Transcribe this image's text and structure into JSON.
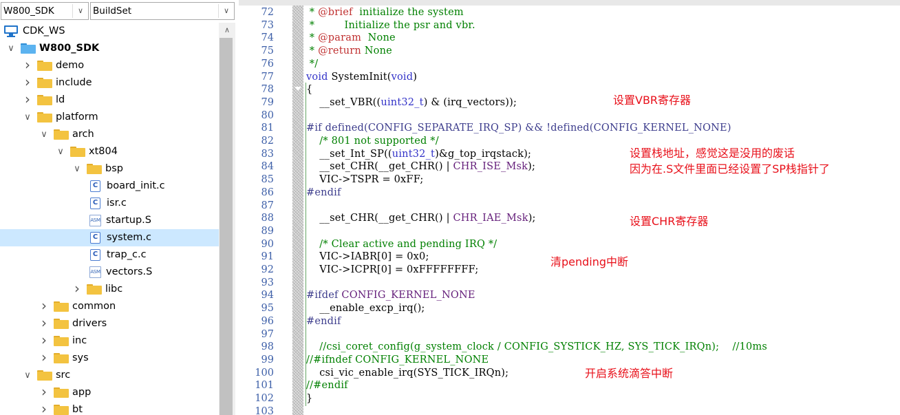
{
  "workspace_combo": {
    "value": "W800_SDK"
  },
  "config_combo": {
    "value": "BuildSet"
  },
  "tree": [
    {
      "label": "CDK_WS",
      "depth": 0,
      "kind": "workspace",
      "expanded": null,
      "selected": false
    },
    {
      "label": "W800_SDK",
      "depth": 0,
      "kind": "project",
      "expanded": true,
      "selected": false,
      "bold": true
    },
    {
      "label": "demo",
      "depth": 1,
      "kind": "folder",
      "expanded": false,
      "selected": false
    },
    {
      "label": "include",
      "depth": 1,
      "kind": "folder",
      "expanded": false,
      "selected": false
    },
    {
      "label": "ld",
      "depth": 1,
      "kind": "folder",
      "expanded": false,
      "selected": false
    },
    {
      "label": "platform",
      "depth": 1,
      "kind": "folder",
      "expanded": true,
      "selected": false
    },
    {
      "label": "arch",
      "depth": 2,
      "kind": "folder",
      "expanded": true,
      "selected": false
    },
    {
      "label": "xt804",
      "depth": 3,
      "kind": "folder",
      "expanded": true,
      "selected": false
    },
    {
      "label": "bsp",
      "depth": 4,
      "kind": "folder",
      "expanded": true,
      "selected": false
    },
    {
      "label": "board_init.c",
      "depth": 5,
      "kind": "c-file",
      "expanded": null,
      "selected": false
    },
    {
      "label": "isr.c",
      "depth": 5,
      "kind": "c-file",
      "expanded": null,
      "selected": false
    },
    {
      "label": "startup.S",
      "depth": 5,
      "kind": "asm-file",
      "expanded": null,
      "selected": false
    },
    {
      "label": "system.c",
      "depth": 5,
      "kind": "c-file",
      "expanded": null,
      "selected": true
    },
    {
      "label": "trap_c.c",
      "depth": 5,
      "kind": "c-file",
      "expanded": null,
      "selected": false
    },
    {
      "label": "vectors.S",
      "depth": 5,
      "kind": "asm-file",
      "expanded": null,
      "selected": false
    },
    {
      "label": "libc",
      "depth": 4,
      "kind": "folder",
      "expanded": false,
      "selected": false
    },
    {
      "label": "common",
      "depth": 2,
      "kind": "folder",
      "expanded": false,
      "selected": false
    },
    {
      "label": "drivers",
      "depth": 2,
      "kind": "folder",
      "expanded": false,
      "selected": false
    },
    {
      "label": "inc",
      "depth": 2,
      "kind": "folder",
      "expanded": false,
      "selected": false
    },
    {
      "label": "sys",
      "depth": 2,
      "kind": "folder",
      "expanded": false,
      "selected": false
    },
    {
      "label": "src",
      "depth": 1,
      "kind": "folder",
      "expanded": true,
      "selected": false
    },
    {
      "label": "app",
      "depth": 2,
      "kind": "folder",
      "expanded": false,
      "selected": false
    },
    {
      "label": "bt",
      "depth": 2,
      "kind": "folder",
      "expanded": false,
      "selected": false
    }
  ],
  "icons": {
    "c_file": "C",
    "asm_file": "ASM"
  },
  "code_lines": [
    {
      "num": "72",
      "segs": [
        [
          "cm",
          " * "
        ],
        [
          "an",
          "@brief"
        ],
        [
          "cm",
          "  initialize the system"
        ]
      ]
    },
    {
      "num": "73",
      "segs": [
        [
          "cm",
          " *         Initialize the psr and vbr."
        ]
      ]
    },
    {
      "num": "74",
      "segs": [
        [
          "cm",
          " * "
        ],
        [
          "an",
          "@param"
        ],
        [
          "cm",
          "  None"
        ]
      ]
    },
    {
      "num": "75",
      "segs": [
        [
          "cm",
          " * "
        ],
        [
          "an",
          "@return"
        ],
        [
          "cm",
          " None"
        ]
      ]
    },
    {
      "num": "76",
      "segs": [
        [
          "cm",
          " */"
        ]
      ]
    },
    {
      "num": "77",
      "segs": [
        [
          "kw",
          "void"
        ],
        [
          "",
          " SystemInit("
        ],
        [
          "kw",
          "void"
        ],
        [
          "",
          ")"
        ]
      ]
    },
    {
      "num": "78",
      "segs": [
        [
          "",
          "{"
        ]
      ]
    },
    {
      "num": "79",
      "segs": [
        [
          "",
          "    __set_VBR(("
        ],
        [
          "kw",
          "uint32_t"
        ],
        [
          "",
          ") & (irq_vectors));"
        ]
      ]
    },
    {
      "num": "80",
      "segs": []
    },
    {
      "num": "81",
      "segs": [
        [
          "pp",
          "#if defined(CONFIG_SEPARATE_IRQ_SP) && !defined(CONFIG_KERNEL_NONE)"
        ]
      ]
    },
    {
      "num": "82",
      "segs": [
        [
          "cm",
          "    /* 801 not supported */"
        ]
      ]
    },
    {
      "num": "83",
      "segs": [
        [
          "",
          "    __set_Int_SP(("
        ],
        [
          "kw",
          "uint32_t"
        ],
        [
          "",
          ")&g_top_irqstack);"
        ]
      ]
    },
    {
      "num": "84",
      "segs": [
        [
          "",
          "    __set_CHR(__get_CHR() | "
        ],
        [
          "mac",
          "CHR_ISE_Msk"
        ],
        [
          "",
          ");"
        ]
      ]
    },
    {
      "num": "85",
      "segs": [
        [
          "",
          "    VIC->TSPR = 0xFF;"
        ]
      ]
    },
    {
      "num": "86",
      "segs": [
        [
          "pp",
          "#endif"
        ]
      ]
    },
    {
      "num": "87",
      "segs": []
    },
    {
      "num": "88",
      "segs": [
        [
          "",
          "    __set_CHR(__get_CHR() | "
        ],
        [
          "mac",
          "CHR_IAE_Msk"
        ],
        [
          "",
          ");"
        ]
      ]
    },
    {
      "num": "89",
      "segs": []
    },
    {
      "num": "90",
      "segs": [
        [
          "cm",
          "    /* Clear active and pending IRQ */"
        ]
      ]
    },
    {
      "num": "91",
      "segs": [
        [
          "",
          "    VIC->IABR[0] = 0x0;"
        ]
      ]
    },
    {
      "num": "92",
      "segs": [
        [
          "",
          "    VIC->ICPR[0] = 0xFFFFFFFF;"
        ]
      ]
    },
    {
      "num": "93",
      "segs": []
    },
    {
      "num": "94",
      "segs": [
        [
          "pp",
          "#ifdef "
        ],
        [
          "mac",
          "CONFIG_KERNEL_NONE"
        ]
      ]
    },
    {
      "num": "95",
      "segs": [
        [
          "",
          "    __enable_excp_irq();"
        ]
      ]
    },
    {
      "num": "96",
      "segs": [
        [
          "pp",
          "#endif"
        ]
      ]
    },
    {
      "num": "97",
      "segs": []
    },
    {
      "num": "98",
      "segs": [
        [
          "cm",
          "    //csi_coret_config(g_system_clock / CONFIG_SYSTICK_HZ, SYS_TICK_IRQn);    //10ms"
        ]
      ]
    },
    {
      "num": "99",
      "segs": [
        [
          "cm",
          "//#ifndef CONFIG_KERNEL_NONE"
        ]
      ]
    },
    {
      "num": "100",
      "segs": [
        [
          "",
          "    csi_vic_enable_irq(SYS_TICK_IRQn);"
        ]
      ]
    },
    {
      "num": "101",
      "segs": [
        [
          "cm",
          "//#endif"
        ]
      ]
    },
    {
      "num": "102",
      "segs": [
        [
          "",
          "}"
        ]
      ]
    },
    {
      "num": "103",
      "segs": []
    }
  ],
  "annotations": {
    "vbr": "设置VBR寄存器",
    "sp_1": "设置栈地址，感觉这是没用的废话",
    "sp_2": "因为在.S文件里面已经设置了SP栈指针了",
    "chr": "设置CHR寄存器",
    "pending": "清pending中断",
    "systick": "开启系统滴答中断"
  },
  "colors": {
    "annotation": "#e8101a",
    "comment": "#008000",
    "keyword": "#3232c8",
    "line_number": "#3d5fa8",
    "selection": "#cce8ff"
  }
}
